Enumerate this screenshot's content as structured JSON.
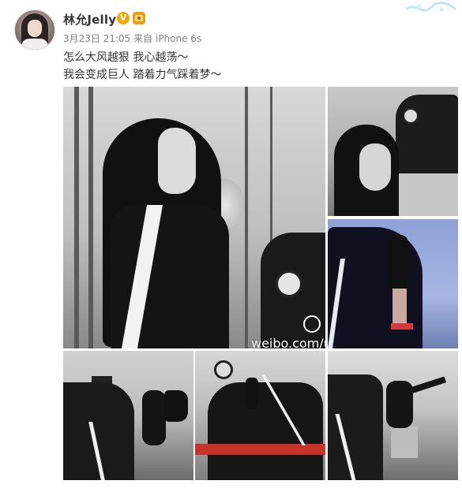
{
  "user": {
    "name": "林允Jelly",
    "vip_badge": "V"
  },
  "post": {
    "date": "3月23日 21:05",
    "source_prefix": "来自",
    "device": "iPhone 6s",
    "lines": [
      "怎么大风越狠 我心越荡～",
      "我会变成巨人 踏着力气踩着梦～"
    ]
  },
  "photos": {
    "watermark": "weibo.com/u/",
    "count": 6
  },
  "icons": {
    "verified": "verified-v-icon",
    "member": "member-crown-icon",
    "weibo_logo": "weibo-eye-icon"
  },
  "colors": {
    "username": "#333333",
    "meta": "#808080",
    "vip": "#f7a800"
  }
}
